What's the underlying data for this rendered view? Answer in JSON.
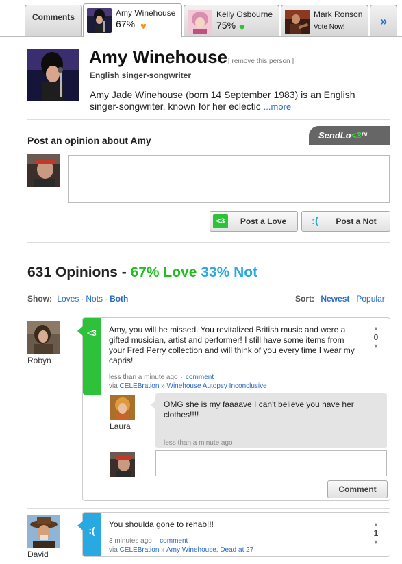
{
  "colors": {
    "love": "#2ec23a",
    "not": "#28a9e2",
    "link": "#2b6cc4",
    "heart_orange": "#f7941d",
    "heart_green": "#2ec23a"
  },
  "tabs": {
    "comments_label": "Comments",
    "people": [
      {
        "name": "Amy Winehouse",
        "percent": "67%",
        "heart": "orange-heart-icon"
      },
      {
        "name": "Kelly Osbourne",
        "percent": "75%",
        "heart": "green-heart-icon"
      },
      {
        "name": "Mark Ronson",
        "cta": "Vote Now!"
      }
    ],
    "more_icon": "»"
  },
  "profile": {
    "name": "Amy Winehouse",
    "remove_link": "[ remove this person ]",
    "subtitle": "English singer-songwriter",
    "bio": "Amy Jade Winehouse (born 14 September 1983) is an English singer-songwriter, known for her eclectic",
    "more_link": "...more"
  },
  "post": {
    "title": "Post an opinion about Amy",
    "brand_part1": "SendLo",
    "brand_part2": "<3",
    "brand_tm": "TM",
    "textarea_value": "",
    "love_icon": "<3",
    "love_label": "Post a Love",
    "not_icon": ":(",
    "not_label": "Post a Not"
  },
  "summary": {
    "count_text": "631 Opinions - ",
    "love_text": "67% Love",
    "not_text": "33% Not"
  },
  "filters": {
    "show_label": "Show:",
    "show_options": [
      "Loves",
      "Nots",
      "Both"
    ],
    "show_selected": "Both",
    "sort_label": "Sort:",
    "sort_options": [
      "Newest",
      "Popular"
    ],
    "sort_selected": "Newest"
  },
  "opinions": [
    {
      "user": "Robyn",
      "type": "love",
      "icon": "<3",
      "text": "Amy, you will be missed. You revitalized British music and were a gifted musician, artist and performer! I still have some items from your Fred Perry collection and will think of you every time I wear my capris!",
      "time": "less than a minute ago",
      "comment_link": "comment",
      "via_label": "via",
      "via_source": "CELEBration",
      "via_sep": "»",
      "via_topic": "Winehouse Autopsy Inconclusive",
      "votes": "0",
      "replies": [
        {
          "user": "Laura",
          "text": "OMG she is my faaaave I can't believe you have her clothes!!!!",
          "time": "less than a minute ago"
        }
      ],
      "reply_input_value": "",
      "comment_button": "Comment"
    },
    {
      "user": "David",
      "type": "not",
      "icon": ":(",
      "text": "You shoulda gone to rehab!!!",
      "time": "3 minutes ago",
      "comment_link": "comment",
      "via_label": "via",
      "via_source": "CELEBration",
      "via_sep": "»",
      "via_topic": "Amy Winehouse, Dead at 27",
      "votes": "1"
    }
  ]
}
